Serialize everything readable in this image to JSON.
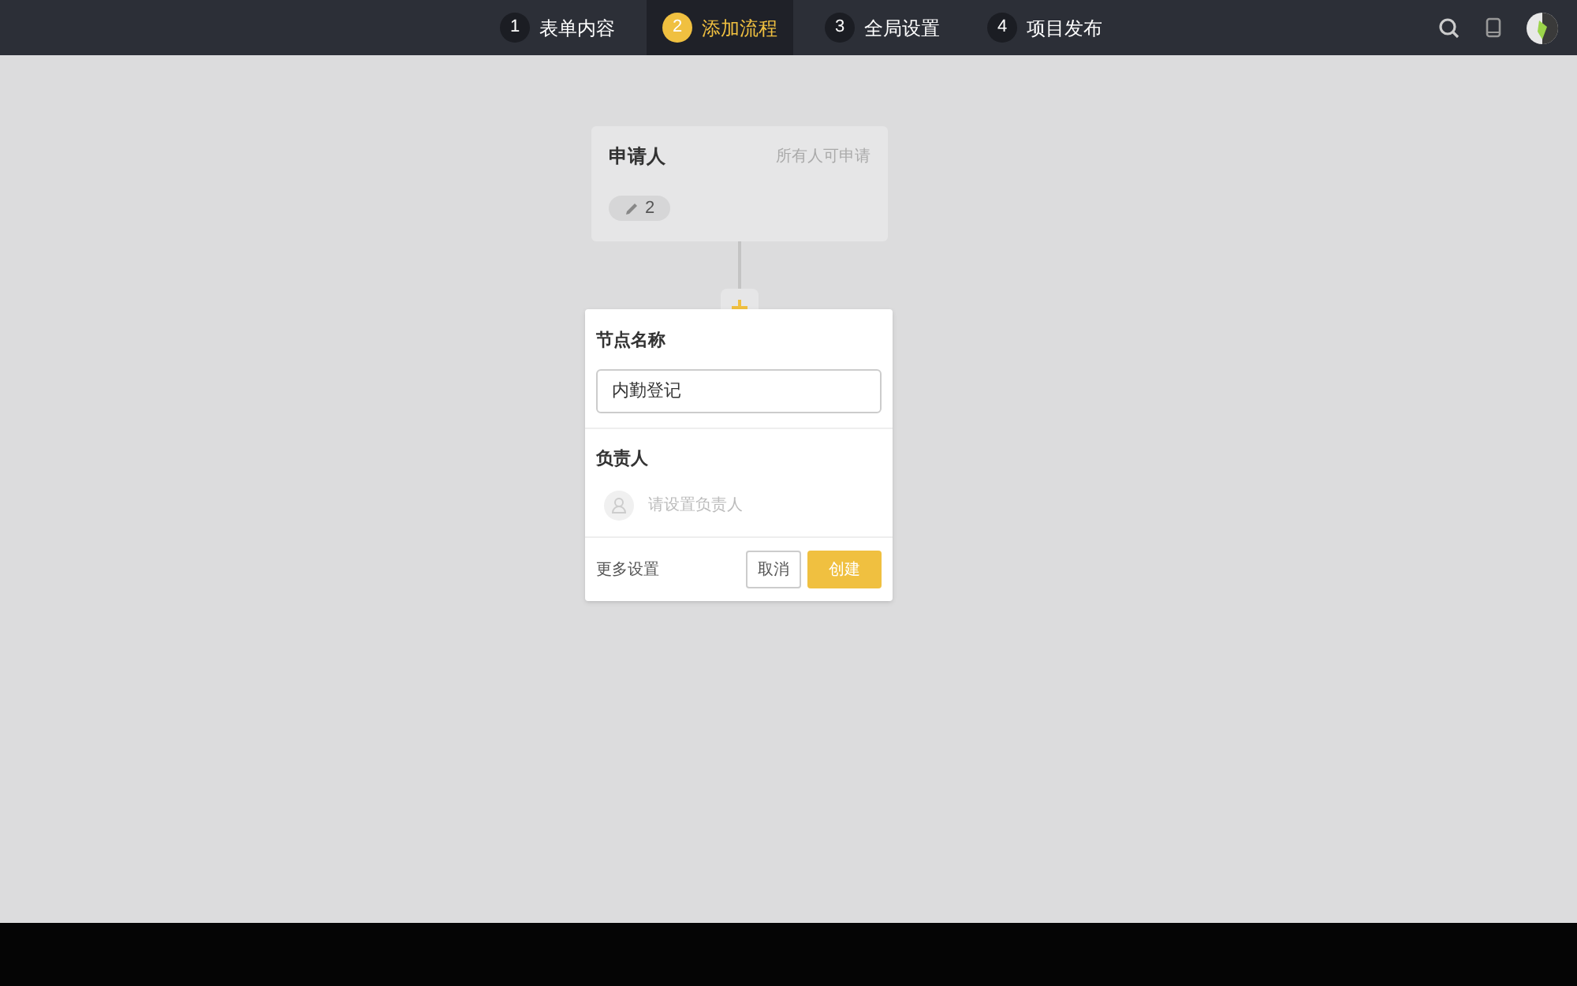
{
  "steps": [
    {
      "number": "1",
      "label": "表单内容",
      "selected": false
    },
    {
      "number": "2",
      "label": "添加流程",
      "selected": true
    },
    {
      "number": "3",
      "label": "全局设置",
      "selected": false
    },
    {
      "number": "4",
      "label": "项目发布",
      "selected": false
    }
  ],
  "applicant_node": {
    "title": "申请人",
    "scope": "所有人可申请",
    "edit_count": "2"
  },
  "node_form": {
    "name_label": "节点名称",
    "name_value": "内勤登记",
    "owner_label": "负责人",
    "owner_placeholder": "请设置负责人",
    "more_settings": "更多设置",
    "cancel": "取消",
    "create": "创建"
  }
}
